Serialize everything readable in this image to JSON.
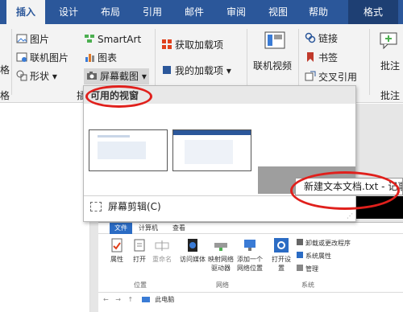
{
  "tabs": [
    "插入",
    "设计",
    "布局",
    "引用",
    "邮件",
    "审阅",
    "视图",
    "帮助",
    "格式"
  ],
  "ribbon": {
    "left_cut_1": "格",
    "left_cut_2": "格",
    "picture": "图片",
    "online_picture": "联机图片",
    "shape": "形状",
    "smartart": "SmartArt",
    "chart": "图表",
    "screenshot": "屏幕截图",
    "group_cut": "插",
    "get_addins": "获取加载项",
    "my_addins": "我的加载项",
    "online_video": "联机视频",
    "link": "链接",
    "bookmark": "书签",
    "cross_ref": "交叉引用",
    "comment": "批注",
    "comment_group": "批注"
  },
  "popup": {
    "header": "可用的视窗",
    "screen_clipping": "屏幕剪辑(C)",
    "tooltip": "新建文本文档.txt - 记事本"
  },
  "explorer": {
    "tabs": [
      "文件",
      "计算机",
      "查看"
    ],
    "properties": "属性",
    "open": "打开",
    "rename": "重命名",
    "media": "访问媒体",
    "map_drive": "映射网络驱动器",
    "add_location": "添加一个网络位置",
    "open_settings": "打开设置",
    "uninstall": "卸载或更改程序",
    "sys_props": "系统属性",
    "manage": "管理",
    "group_location": "位置",
    "group_network": "网络",
    "group_system": "系统",
    "address": "此电脑"
  },
  "colors": {
    "brand": "#2b579a",
    "annotation": "#e0201c"
  }
}
